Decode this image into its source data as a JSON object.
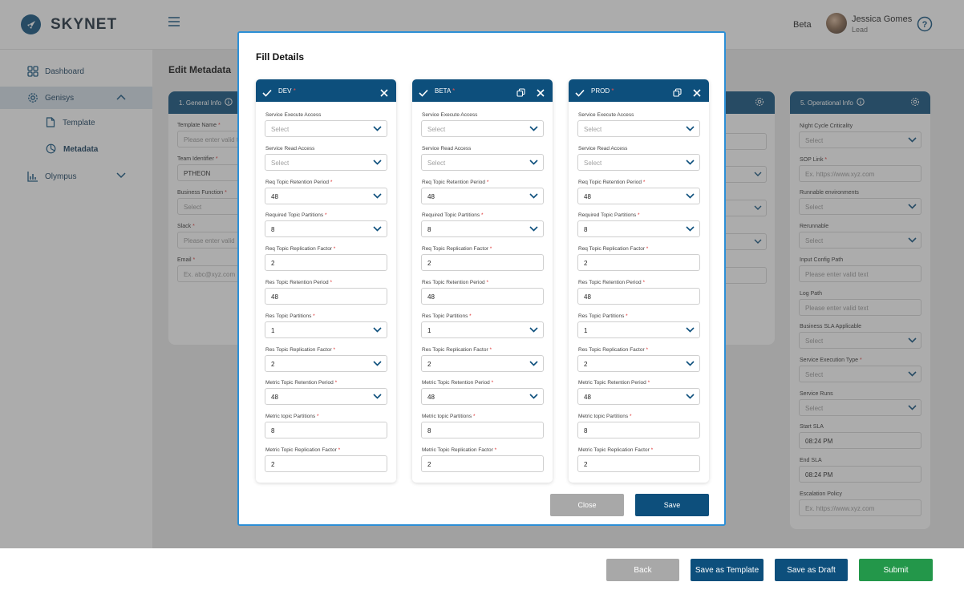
{
  "app": {
    "name": "SKYNET"
  },
  "header": {
    "env": "Beta",
    "user_name": "Jessica Gomes",
    "user_role": "Lead"
  },
  "sidebar": {
    "items": [
      {
        "label": "Dashboard"
      },
      {
        "label": "Genisys"
      },
      {
        "label": "Olympus"
      }
    ],
    "sub_items": [
      {
        "label": "Template"
      },
      {
        "label": "Metadata"
      }
    ]
  },
  "page": {
    "title": "Edit Metadata"
  },
  "bg_general": {
    "title": "1. General Info",
    "fields": [
      {
        "label": "Template Name",
        "required": "*",
        "value": "Please enter valid t"
      },
      {
        "label": "Team Identifier",
        "required": "*",
        "value": "PTHEON"
      },
      {
        "label": "Business Function",
        "required": "*",
        "value": "Select"
      },
      {
        "label": "Slack",
        "required": "*",
        "value": "Please enter valid"
      },
      {
        "label": "Email",
        "required": "*",
        "value": "Ex. abc@xyz.com"
      }
    ]
  },
  "bg_ops": {
    "title": "5. Operational Info",
    "fields": [
      {
        "label": "Night  Cycle Criticality",
        "required": "",
        "value": "Select"
      },
      {
        "label": "SOP Link",
        "required": "*",
        "value": "Ex. https://www.xyz.com"
      },
      {
        "label": "Runnable environments",
        "required": "",
        "value": "Select"
      },
      {
        "label": "Rerunnable",
        "required": "",
        "value": "Select"
      },
      {
        "label": "Input Config Path",
        "required": "",
        "value": "Please enter valid text"
      },
      {
        "label": "Log Path",
        "required": "",
        "value": "Please enter valid text"
      },
      {
        "label": "Business SLA Applicable",
        "required": "",
        "value": "Select"
      },
      {
        "label": "Service Execution Type",
        "required": "*",
        "value": "Select"
      },
      {
        "label": "Service Runs",
        "required": "",
        "value": "Select"
      },
      {
        "label": "Start SLA",
        "required": "",
        "value": "08:24 PM"
      },
      {
        "label": "End SLA",
        "required": "",
        "value": "08:24 PM"
      },
      {
        "label": "Escalation Policy",
        "required": "",
        "value": "Ex. https://www.xyz.com"
      }
    ]
  },
  "modal": {
    "title": "Fill Details",
    "close_label": "Close",
    "save_label": "Save",
    "envs": [
      {
        "name": "DEV",
        "required": "*",
        "fields": [
          {
            "label": "Service Execute Access",
            "required": "",
            "value": "Select"
          },
          {
            "label": "Service Read Access",
            "required": "",
            "value": "Select"
          },
          {
            "label": "Req Topic Retention Period",
            "required": "*",
            "value": "48"
          },
          {
            "label": "Required Topic Partitions",
            "required": "*",
            "value": "8"
          },
          {
            "label": "Req Topic Replication Factor",
            "required": "*",
            "value": "2"
          },
          {
            "label": "Res Topic Retention Period",
            "required": "*",
            "value": "48"
          },
          {
            "label": "Res Topic Partitions",
            "required": "*",
            "value": "1"
          },
          {
            "label": "Res Topic Replication Factor",
            "required": "*",
            "value": "2"
          },
          {
            "label": "Metric Topic Retention Period",
            "required": "*",
            "value": "48"
          },
          {
            "label": "Metric topic Partitions",
            "required": "*",
            "value": "8"
          },
          {
            "label": "Metric Topic Replication Factor",
            "required": "*",
            "value": "2"
          }
        ]
      },
      {
        "name": "BETA",
        "required": "*",
        "fields": [
          {
            "label": "Service Execute Access",
            "required": "",
            "value": "Select"
          },
          {
            "label": "Service Read Access",
            "required": "",
            "value": "Select"
          },
          {
            "label": "Req Topic Retention Period",
            "required": "*",
            "value": "48"
          },
          {
            "label": "Required Topic Partitions",
            "required": "*",
            "value": "8"
          },
          {
            "label": "Req Topic Replication Factor",
            "required": "*",
            "value": "2"
          },
          {
            "label": "Res Topic Retention Period",
            "required": "*",
            "value": "48"
          },
          {
            "label": "Res Topic Partitions",
            "required": "*",
            "value": "1"
          },
          {
            "label": "Res Topic Replication Factor",
            "required": "*",
            "value": "2"
          },
          {
            "label": "Metric Topic Retention Period",
            "required": "*",
            "value": "48"
          },
          {
            "label": "Metric topic Partitions",
            "required": "*",
            "value": "8"
          },
          {
            "label": "Metric Topic Replication Factor",
            "required": "*",
            "value": "2"
          }
        ]
      },
      {
        "name": "PROD",
        "required": "*",
        "fields": [
          {
            "label": "Service Execute Access",
            "required": "",
            "value": "Select"
          },
          {
            "label": "Service Read Access",
            "required": "",
            "value": "Select"
          },
          {
            "label": "Req Topic Retention Period",
            "required": "*",
            "value": "48"
          },
          {
            "label": "Required Topic Partitions",
            "required": "*",
            "value": "8"
          },
          {
            "label": "Req Topic Replication Factor",
            "required": "*",
            "value": "2"
          },
          {
            "label": "Res Topic Retention Period",
            "required": "*",
            "value": "48"
          },
          {
            "label": "Res Topic Partitions",
            "required": "*",
            "value": "1"
          },
          {
            "label": "Res Topic Replication Factor",
            "required": "*",
            "value": "2"
          },
          {
            "label": "Metric Topic Retention Period",
            "required": "*",
            "value": "48"
          },
          {
            "label": "Metric topic Partitions",
            "required": "*",
            "value": "8"
          },
          {
            "label": "Metric Topic Replication Factor",
            "required": "*",
            "value": "2"
          }
        ]
      }
    ]
  },
  "footer": {
    "back_label": "Back",
    "save_template_label": "Save as Template",
    "save_draft_label": "Save as Draft",
    "submit_label": "Submit"
  },
  "colors": {
    "primary": "#0d4f7c",
    "accent": "#2c8fd6",
    "submit": "#23974a",
    "neutral": "#a8a8a8"
  }
}
